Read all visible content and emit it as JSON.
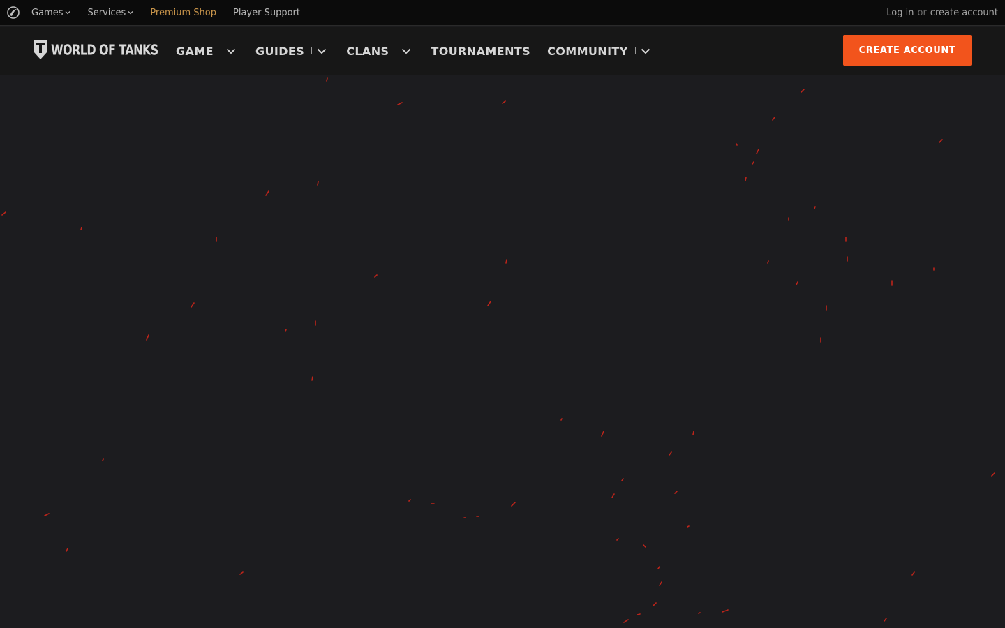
{
  "topbar": {
    "games_label": "Games",
    "services_label": "Services",
    "premium_label": "Premium Shop",
    "support_label": "Player Support",
    "login_label": "Log in",
    "or_label": "or",
    "create_label": "create account"
  },
  "header": {
    "brand_text": "WORLD OF TANKS",
    "nav": {
      "game": "GAME",
      "guides": "GUIDES",
      "clans": "CLANS",
      "tournaments": "TOURNAMENTS",
      "community": "COMMUNITY"
    },
    "cta_label": "CREATE ACCOUNT"
  },
  "colors": {
    "cta": "#f2541c",
    "premium": "#c8944a",
    "ember": "#d8261a",
    "background": "#1c1c1f"
  }
}
